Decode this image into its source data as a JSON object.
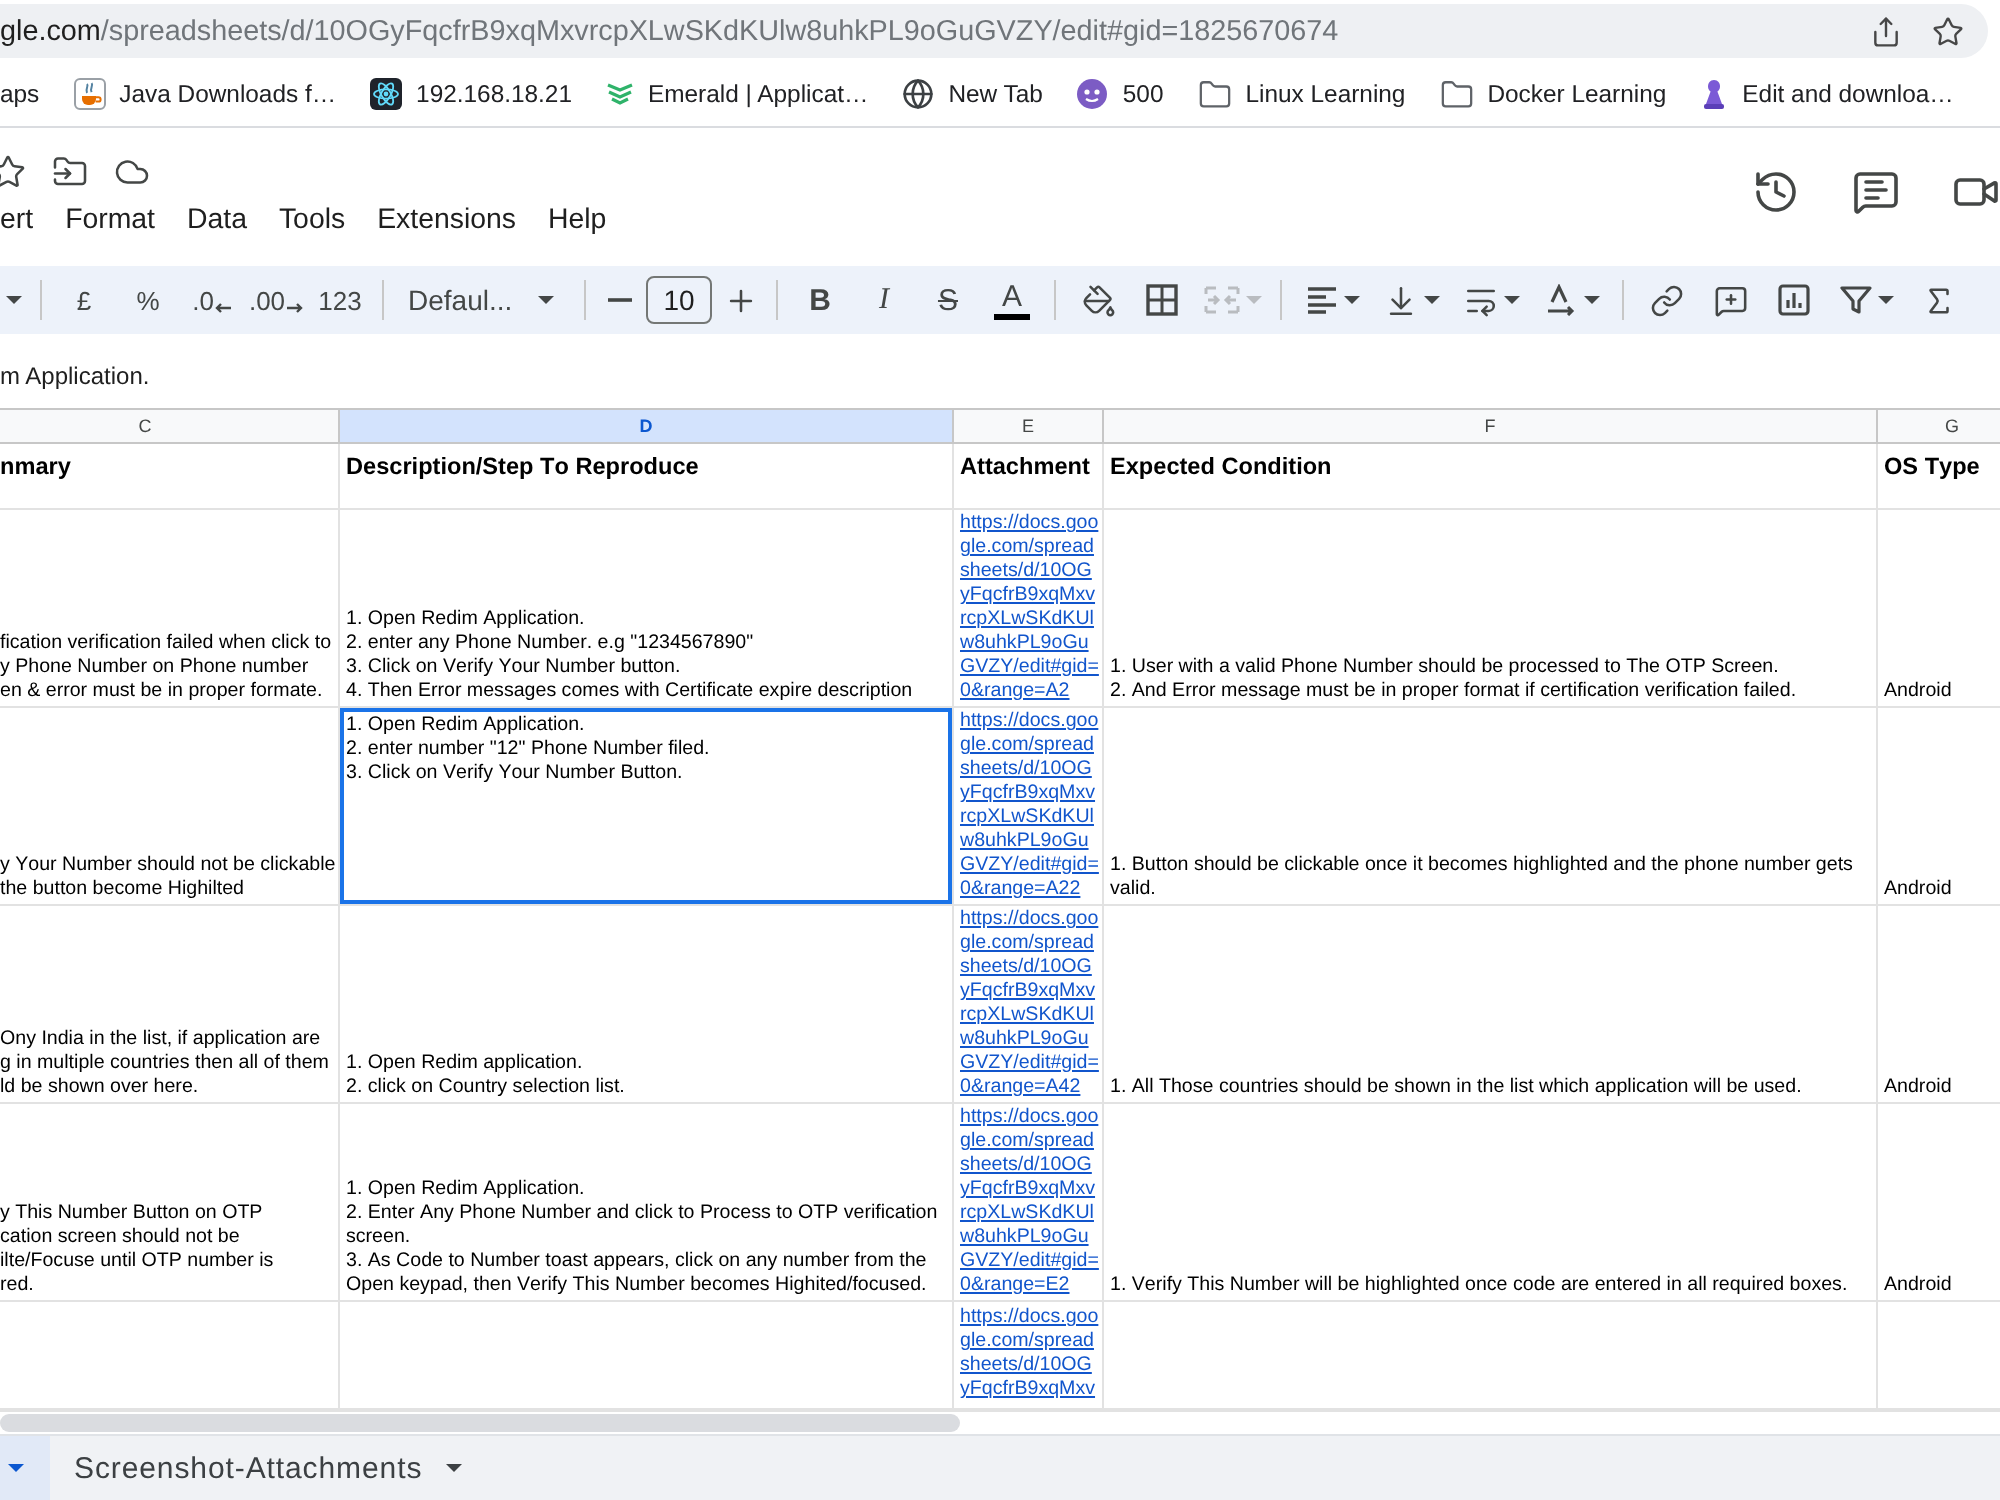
{
  "browser": {
    "address": {
      "host": "gle.com",
      "path": "/spreadsheets/d/10OGyFqcfrB9xqMxvrcpXLwSKdKUlw8uhkPL9oGuGVZY/edit#gid=1825670674"
    }
  },
  "bookmarks": [
    {
      "label": "aps"
    },
    {
      "label": "Java Downloads f…"
    },
    {
      "label": "192.168.18.21"
    },
    {
      "label": "Emerald | Applicat…"
    },
    {
      "label": "New Tab"
    },
    {
      "label": "500"
    },
    {
      "label": "Linux Learning"
    },
    {
      "label": "Docker Learning"
    },
    {
      "label": "Edit and downloa…"
    }
  ],
  "menu": [
    "ert",
    "Format",
    "Data",
    "Tools",
    "Extensions",
    "Help"
  ],
  "toolbar": {
    "number_formats": [
      {
        "kind": "plain",
        "label": "£"
      },
      {
        "kind": "plain",
        "label": "%"
      },
      {
        "kind": "decrease",
        "label": ".0"
      },
      {
        "kind": "increase",
        "label": ".00"
      },
      {
        "kind": "plain",
        "label": "123"
      }
    ],
    "font": "Defaul...",
    "font_size": "10",
    "text_styles": [
      {
        "kind": "bold",
        "label": "B"
      },
      {
        "kind": "italic",
        "label": "I"
      },
      {
        "kind": "strike",
        "label": "S"
      },
      {
        "kind": "color",
        "label": "A"
      }
    ],
    "merge": {
      "disabled": true
    }
  },
  "formula_bar": {
    "value": "m Application."
  },
  "grid": {
    "columns": [
      {
        "label": "C",
        "selected": false
      },
      {
        "label": "D",
        "selected": true
      },
      {
        "label": "E",
        "selected": false
      },
      {
        "label": "F",
        "selected": false
      },
      {
        "label": "G",
        "selected": false
      }
    ],
    "header": [
      "nmary",
      "Description/Step To Reproduce",
      "Attachment",
      "Expected Condition",
      "OS Type"
    ],
    "rows": [
      {
        "cells": [
          {
            "kind": "text",
            "text": "fication verification failed when click to\ny Phone Number on Phone number\nen & error must be in proper formate.",
            "top_aligned": false,
            "selected": false
          },
          {
            "kind": "text",
            "text": "1. Open Redim Application.\n2. enter any Phone Number. e.g \"1234567890\"\n3. Click on Verify Your Number button.\n4. Then Error messages comes with Certificate expire description",
            "top_aligned": false,
            "selected": false
          },
          {
            "kind": "link",
            "text": "https://docs.google.com/spreadsheets/d/10OGyFqcfrB9xqMxvrcpXLwSKdKUlw8uhkPL9oGuGVZY/edit#gid=0&range=A2",
            "top_aligned": false,
            "selected": false
          },
          {
            "kind": "text",
            "text": "1. User with a valid Phone Number should be processed to The OTP Screen.\n2. And Error message must be in proper format if certification verification failed.",
            "top_aligned": false,
            "selected": false
          },
          {
            "kind": "text",
            "text": "Android",
            "top_aligned": false,
            "selected": false
          }
        ]
      },
      {
        "cells": [
          {
            "kind": "text",
            "text": "y Your Number should not be clickable\nthe button become Highilted",
            "top_aligned": false,
            "selected": false
          },
          {
            "kind": "text",
            "text": "1. Open Redim Application.\n2. enter number \"12\" Phone Number filed.\n3. Click on Verify Your Number Button.",
            "top_aligned": true,
            "selected": true
          },
          {
            "kind": "link",
            "text": "https://docs.google.com/spreadsheets/d/10OGyFqcfrB9xqMxvrcpXLwSKdKUlw8uhkPL9oGuGVZY/edit#gid=0&range=A22",
            "top_aligned": false,
            "selected": false
          },
          {
            "kind": "text",
            "text": "1. Button should be clickable once it becomes highlighted and the phone number gets valid.",
            "top_aligned": false,
            "selected": false
          },
          {
            "kind": "text",
            "text": "Android",
            "top_aligned": false,
            "selected": false
          }
        ]
      },
      {
        "cells": [
          {
            "kind": "text",
            "text": "Ony India in the list, if application are\ng in multiple countries then all of them\nld be shown over here.",
            "top_aligned": false,
            "selected": false
          },
          {
            "kind": "text",
            "text": "1. Open Redim application.\n2. click on Country selection list.",
            "top_aligned": false,
            "selected": false
          },
          {
            "kind": "link",
            "text": "https://docs.google.com/spreadsheets/d/10OGyFqcfrB9xqMxvrcpXLwSKdKUlw8uhkPL9oGuGVZY/edit#gid=0&range=A42",
            "top_aligned": false,
            "selected": false
          },
          {
            "kind": "text",
            "text": "1. All Those countries should be shown in the list which application will be used.",
            "top_aligned": false,
            "selected": false
          },
          {
            "kind": "text",
            "text": "Android",
            "top_aligned": false,
            "selected": false
          }
        ]
      },
      {
        "cells": [
          {
            "kind": "text",
            "text": "y This Number Button on OTP\ncation screen should not be\nilte/Focuse until OTP number is\nred.",
            "top_aligned": false,
            "selected": false
          },
          {
            "kind": "text",
            "text": "1. Open Redim Application.\n2. Enter Any Phone Number and click to Process to OTP verification screen.\n3. As Code to Number toast appears, click on any number from the Open keypad, then Verify This Number becomes Highited/focused.",
            "top_aligned": false,
            "selected": false
          },
          {
            "kind": "link",
            "text": "https://docs.google.com/spreadsheets/d/10OGyFqcfrB9xqMxvrcpXLwSKdKUlw8uhkPL9oGuGVZY/edit#gid=0&range=E2",
            "top_aligned": false,
            "selected": false
          },
          {
            "kind": "text",
            "text": "1. Verify This Number will be highlighted once code are entered in all required boxes.",
            "top_aligned": false,
            "selected": false
          },
          {
            "kind": "text",
            "text": "Android",
            "top_aligned": false,
            "selected": false
          }
        ]
      },
      {
        "cells": [
          {
            "kind": "empty",
            "selected": false
          },
          {
            "kind": "empty",
            "selected": false
          },
          {
            "kind": "link",
            "text": "https://docs.google.com/spreadsheets/d/10OGyFqcfrB9xqMxv",
            "top_aligned": true,
            "selected": false
          },
          {
            "kind": "empty",
            "selected": false
          },
          {
            "kind": "empty",
            "selected": false
          }
        ]
      }
    ]
  },
  "sheet_tabs": [
    {
      "selected": true
    },
    {
      "label": "Screenshot-Attachments",
      "selected": false
    }
  ]
}
